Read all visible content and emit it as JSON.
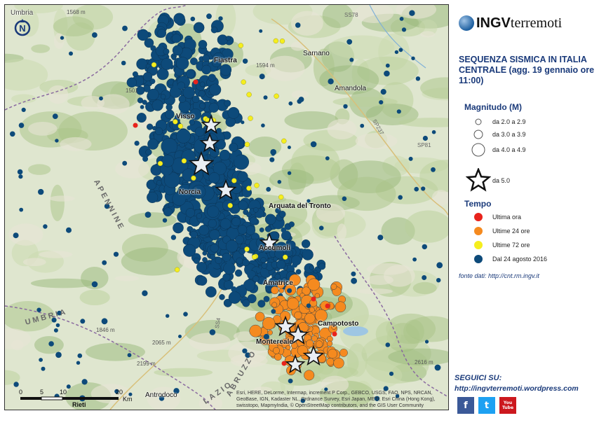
{
  "map": {
    "places": [
      "Fiastra",
      "Sarnano",
      "Amandola",
      "Visso",
      "Norcia",
      "Arquata del Tronto",
      "Accumoli",
      "Amatrice",
      "Campotosto",
      "Montereale",
      "Antrodoco",
      "Umbria"
    ],
    "regions": [
      "APENNINE",
      "UMBRIA",
      "LAZIO",
      "ABRUZZO"
    ],
    "elevations": [
      "1568 m",
      "1594 m",
      "1501",
      "1846 m",
      "2065 m",
      "2199 m",
      "2616 m"
    ],
    "roads": [
      "SS78",
      "SS4",
      "SP237",
      "SP81"
    ],
    "scale": {
      "ticks": [
        "0",
        "5",
        "10",
        "20"
      ],
      "unit": "Km",
      "label": "Rieti"
    },
    "credit": "Esri, HERE, DeLorme, Intermap, increment P Corp., GEBCO, USGS, FAO, NPS, NRCAN, GeoBase, IGN, Kadaster NL, Ordnance Survey, Esri Japan, METI, Esri China (Hong Kong), swisstopo, MapmyIndia, © OpenStreetMap contributors, and the GIS User Community"
  },
  "panel": {
    "logo_a": "INGV",
    "logo_b": "terremoti",
    "title": "SEQUENZA SISMICA IN ITALIA CENTRALE (agg. 19 gennaio ore 11:00)",
    "magnitude_title": "Magnitudo (M)",
    "magnitude_items": [
      "da 2.0 a 2.9",
      "da 3.0 a 3.9",
      "da 4.0 a 4.9",
      "da 5.0"
    ],
    "time_title": "Tempo",
    "time_items": [
      {
        "label": "Ultima ora",
        "color": "#e8231c"
      },
      {
        "label": "Ultime 24 ore",
        "color": "#f58a1f"
      },
      {
        "label": "Ultime 72 ore",
        "color": "#f5ee1e"
      },
      {
        "label": "Dal 24 agosto 2016",
        "color": "#0d4a7a"
      }
    ],
    "source": "fonte dati: http://cnt.rm.ingv.it",
    "follow": "SEGUICI SU:",
    "blog": "http://ingvterremoti.wordpress.com",
    "social": [
      "f",
      "t",
      "You Tube"
    ]
  },
  "colors": {
    "blue": "#0d4a7a",
    "orange": "#f58a1f",
    "yellow": "#f5ee1e",
    "red": "#e8231c",
    "title": "#1a3a7a"
  }
}
